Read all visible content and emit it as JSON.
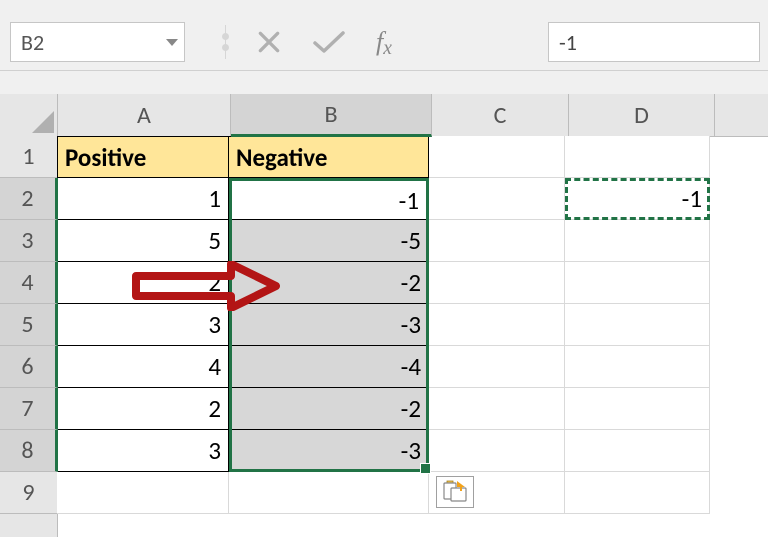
{
  "namebox": {
    "value": "B2"
  },
  "formula_bar": {
    "value": "-1"
  },
  "columns": [
    "A",
    "B",
    "C",
    "D"
  ],
  "rows": [
    "1",
    "2",
    "3",
    "4",
    "5",
    "6",
    "7",
    "8",
    "9"
  ],
  "headers": {
    "A": "Positive",
    "B": "Negative"
  },
  "data": {
    "A": {
      "2": "1",
      "3": "5",
      "4": "2",
      "5": "3",
      "6": "4",
      "7": "2",
      "8": "3"
    },
    "B": {
      "2": "-1",
      "3": "-5",
      "4": "-2",
      "5": "-3",
      "6": "-4",
      "7": "-2",
      "8": "-3"
    },
    "D": {
      "2": "-1"
    }
  },
  "active_cell_value": "-1",
  "selected_column": "B",
  "chart_data": {
    "type": "table",
    "columns": [
      "Positive",
      "Negative"
    ],
    "rows": [
      {
        "Positive": 1,
        "Negative": -1
      },
      {
        "Positive": 5,
        "Negative": -5
      },
      {
        "Positive": 2,
        "Negative": -2
      },
      {
        "Positive": 3,
        "Negative": -3
      },
      {
        "Positive": 4,
        "Negative": -4
      },
      {
        "Positive": 2,
        "Negative": -2
      },
      {
        "Positive": 3,
        "Negative": -3
      }
    ]
  }
}
